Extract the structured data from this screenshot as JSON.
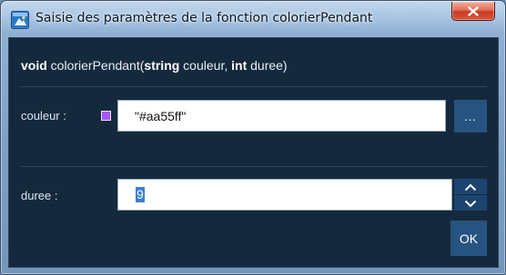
{
  "window": {
    "title": "Saisie des paramètres de la fonction colorierPendant",
    "app_icon": "app-window-icon",
    "close_icon": "close-icon"
  },
  "signature": {
    "return_type": "void",
    "function_name": "colorierPendant(",
    "param1_type": "string",
    "param1_name": " couleur, ",
    "param2_type": "int",
    "param2_name": " duree)"
  },
  "params": {
    "couleur": {
      "label": "couleur :",
      "value": "\"#aa55ff\"",
      "swatch_color": "#aa55ff",
      "browse_label": "..."
    },
    "duree": {
      "label": "duree :",
      "value": "9",
      "spin_up_icon": "chevron-up-icon",
      "spin_down_icon": "chevron-down-icon"
    }
  },
  "ok_label": "OK",
  "colors": {
    "client_bg": "#15293d",
    "button_bg": "#26537f",
    "selection": "#3c7ed3",
    "close_red": "#c73b22"
  }
}
